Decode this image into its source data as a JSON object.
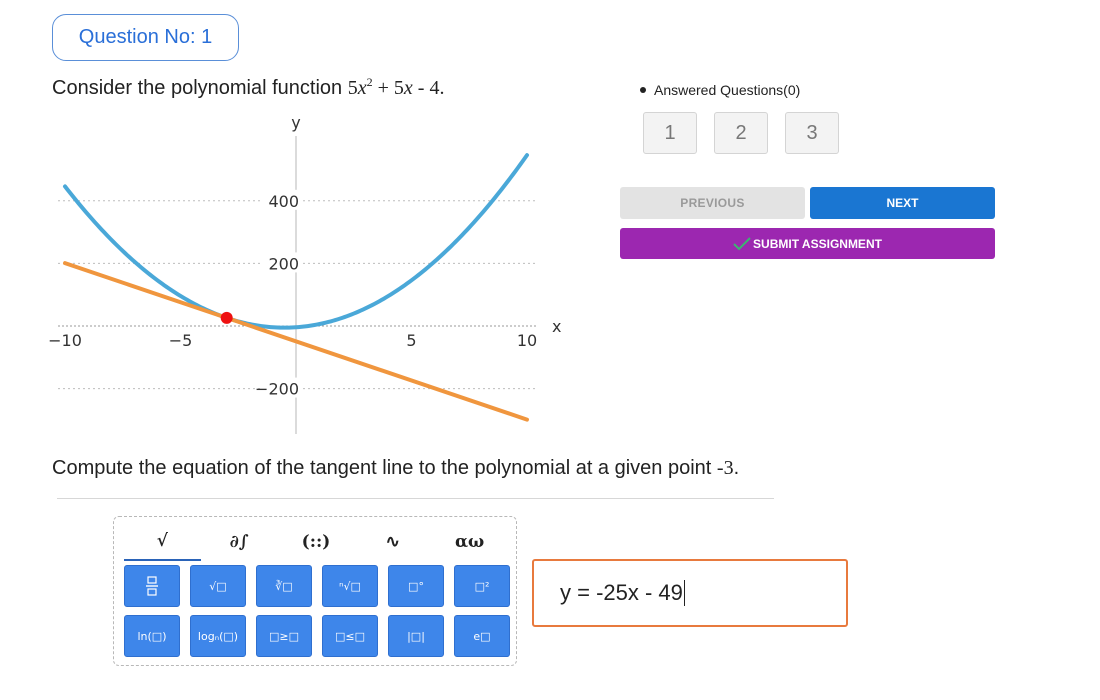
{
  "question": {
    "label": "Question No: 1"
  },
  "prompt1": {
    "text": "Consider the polynomial function",
    "coef_a": "5",
    "var": "x",
    "exp": "2",
    "plus": " + 5",
    "minus": " - 4",
    "end": "."
  },
  "prompt2": {
    "text": "Compute the equation of the tangent line to the polynomial at a given point",
    "point": "-3",
    "end": "."
  },
  "graph": {
    "x_axis_label": "x",
    "y_axis_label": "y",
    "x_ticks": [
      "−10",
      "−5",
      "5",
      "10"
    ],
    "y_ticks": [
      "400",
      "200",
      "−200"
    ],
    "curve_color": "#4aa8d8",
    "tangent_color": "#f0963e",
    "point_color": "#ee1111"
  },
  "chart_data": {
    "type": "line",
    "xlim": [
      -10,
      10
    ],
    "ylim": [
      -300,
      550
    ],
    "series": [
      {
        "kind": "parabola",
        "formula": "5x^2 + 5x - 4",
        "x_range": [
          -10,
          10
        ]
      },
      {
        "kind": "tangent",
        "formula": "-25x - 49",
        "x_range": [
          -10,
          10
        ]
      }
    ],
    "points": [
      {
        "x": -3,
        "y": 26
      }
    ],
    "grid": "horizontal-dotted"
  },
  "keypad": {
    "tabs": [
      "√",
      "∂∫",
      "(::)",
      "∿",
      "αω"
    ],
    "row1": [
      "frac",
      "√□",
      "∛□",
      "ⁿ√□",
      "□°",
      "□²"
    ],
    "row2": [
      "ln(□)",
      "logₙ(□)",
      "□≥□",
      "□≤□",
      "|□|",
      "e□"
    ]
  },
  "answer": {
    "value": "y = -25x - 49"
  },
  "sidebar": {
    "answered_label": "Answered Questions(0)",
    "question_numbers": [
      "1",
      "2",
      "3"
    ],
    "previous_label": "PREVIOUS",
    "next_label": "NEXT",
    "submit_label": "SUBMIT ASSIGNMENT"
  },
  "colors": {
    "accent": "#1a76d2",
    "submit": "#9c27b0",
    "answer_border": "#e87a3e"
  }
}
